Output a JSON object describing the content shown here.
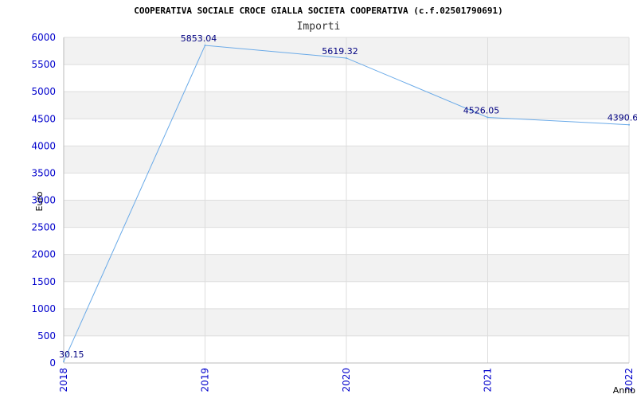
{
  "chart_data": {
    "type": "line",
    "title": "COOPERATIVA SOCIALE CROCE GIALLA SOCIETA COOPERATIVA (c.f.02501790691)",
    "subtitle": "Importi",
    "xlabel": "Anno",
    "ylabel": "Euro",
    "categories": [
      "2018",
      "2019",
      "2020",
      "2021",
      "2022"
    ],
    "series": [
      {
        "values": [
          30.15,
          5853.04,
          5619.32,
          4526.05,
          4390.6
        ],
        "labels": [
          "30.15",
          "5853.04",
          "5619.32",
          "4526.05",
          "4390.6"
        ]
      }
    ],
    "ylim": [
      0,
      6000
    ],
    "yticks": [
      0,
      500,
      1000,
      1500,
      2000,
      2500,
      3000,
      3500,
      4000,
      4500,
      5000,
      5500,
      6000
    ],
    "grid": true,
    "line_color": "#6aaae8",
    "band_color": "#f2f2f2",
    "tick_color": "#0000cc",
    "label_color": "#000080"
  }
}
